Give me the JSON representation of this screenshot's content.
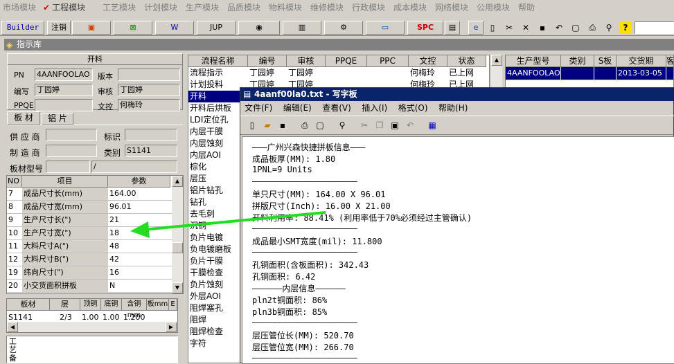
{
  "menu": [
    "市场模块",
    "工程模块",
    "工艺模块",
    "计划模块",
    "生产模块",
    "品质模块",
    "物料模块",
    "维修模块",
    "行政模块",
    "成本模块",
    "网络模块",
    "公用模块",
    "帮助"
  ],
  "toolbar": {
    "builder": "Builder",
    "logout": "注销",
    "jup": "JUP",
    "spc": "SPC"
  },
  "panel_title": "指示库",
  "form": {
    "group_title": "开料",
    "pn_label": "PN",
    "pn_value": "4AANFOOLAO",
    "version_label": "版本",
    "author_label": "编写",
    "author_value": "丁园婷",
    "review_label": "审核",
    "review_value": "丁园婷",
    "ppqe_label": "PPQE",
    "doc_label": "文控",
    "doc_value": "何梅玲"
  },
  "tabs": [
    "板 材",
    "铝 片"
  ],
  "material": {
    "supplier_label": "供 应 商",
    "mark_label": "标识",
    "maker_label": "制 造 商",
    "class_label": "类别",
    "class_value": "S1141",
    "model_label": "板材型号",
    "model_value2": "/"
  },
  "params": {
    "headers": [
      "NO",
      "项目",
      "参数"
    ],
    "rows": [
      [
        "7",
        "成品尺寸长(mm)",
        "164.00"
      ],
      [
        "8",
        "成品尺寸宽(mm)",
        "96.01"
      ],
      [
        "9",
        "生产尺寸长(\")",
        "21"
      ],
      [
        "10",
        "生产尺寸宽(\")",
        "18"
      ],
      [
        "11",
        "大料尺寸A(\")",
        "48"
      ],
      [
        "12",
        "大料尺寸B(\")",
        "42"
      ],
      [
        "19",
        "纬向尺寸(\")",
        "16"
      ],
      [
        "20",
        "小交货面积拼板",
        "N"
      ]
    ]
  },
  "board": {
    "headers": [
      "板材",
      "层",
      "顶铜",
      "底铜",
      "含铜mm",
      "板mm",
      "E"
    ],
    "row": [
      "S1141",
      "2/3",
      "1.00",
      "1.00",
      "1.200"
    ]
  },
  "vertical_label": "工艺备",
  "process": {
    "headers": [
      "流程名称",
      "编号",
      "审核",
      "PPQE",
      "PPC",
      "文控",
      "状态"
    ],
    "rows": [
      [
        "流程指示",
        "丁园婷",
        "丁园婷",
        "何梅玲",
        "已上网"
      ],
      [
        "计划投料",
        "丁园婷",
        "丁园婷",
        "何梅玲",
        "已上网"
      ]
    ],
    "list": [
      "开料",
      "开料后烘板",
      "LDI定位孔",
      "内层干膜",
      "内层蚀刻",
      "内层AOI",
      "棕化",
      "层压",
      "铝片钻孔",
      "钻孔",
      "去毛刺",
      "沉铜",
      "负片电镀",
      "负电镀磨板",
      "负片干膜",
      "干膜检查",
      "负片蚀刻",
      "外层AOI",
      "阻焊塞孔",
      "阻焊",
      "阻焊检查",
      "字符"
    ]
  },
  "right": {
    "headers": [
      "生产型号",
      "类别",
      "S板",
      "交货期",
      "客"
    ],
    "row": [
      "4AANFOOLAO",
      "",
      "",
      "2013-03-05",
      ""
    ]
  },
  "wordpad": {
    "title": "4aanf00la0.txt - 写字板",
    "menu": [
      "文件(F)",
      "编辑(E)",
      "查看(V)",
      "插入(I)",
      "格式(O)",
      "帮助(H)"
    ],
    "lines": [
      "———广州兴森快捷拼板信息———",
      "成品板厚(MM): 1.80",
      "1PNL=9 Units",
      "—————————————————————",
      "单只尺寸(MM): 164.00 X 96.01",
      "拼版尺寸(Inch): 16.00 X 21.00",
      "开料利用率: 88.41% (利用率低于70%必须经过主管确认)",
      "—————————————————————",
      "成品最小SMT宽度(mil): 11.800",
      "—————————————————————",
      "孔铜面积(含板面积): 342.43",
      "孔铜面积: 6.42",
      "——————内层信息——————",
      "pln2t铜面积: 86%",
      "pln3b铜面积: 85%",
      "—————————————————————",
      "层压管位长(MM): 520.70",
      "层压管位宽(MM): 266.70",
      "—————————————————————"
    ]
  },
  "colors": {
    "accent": "#0a246a",
    "arrow": "#22dd22",
    "selection": "#000080"
  }
}
